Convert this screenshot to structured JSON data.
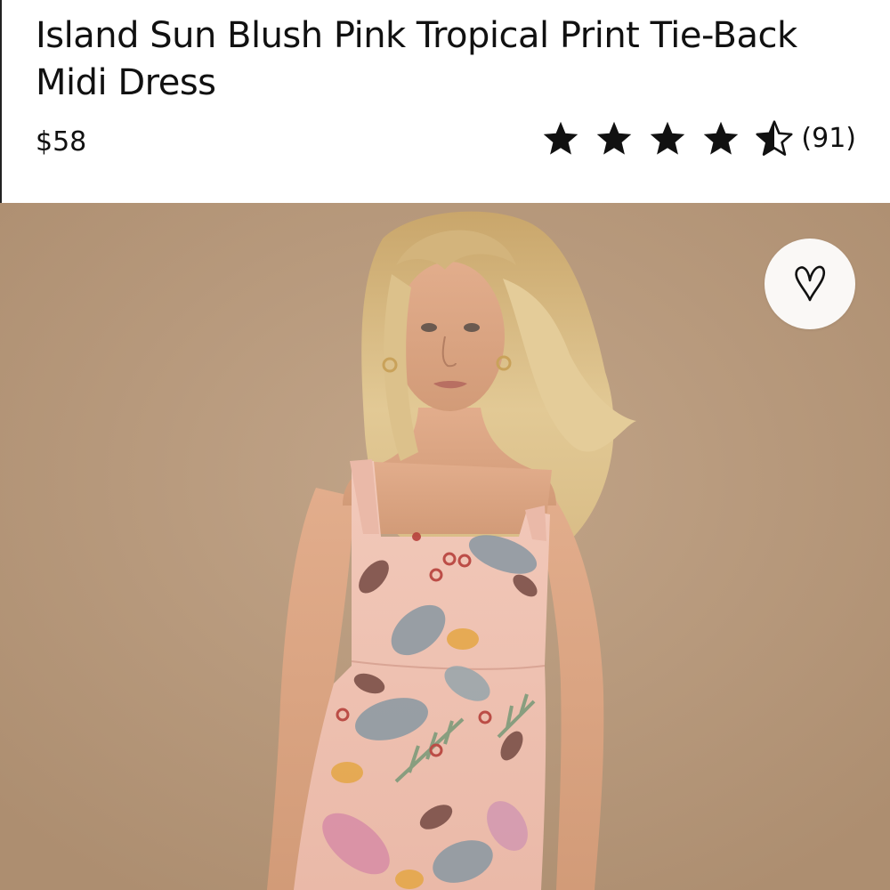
{
  "product": {
    "title": "Island Sun Blush Pink Tropical Print Tie-Back Midi Dress",
    "price": "$58",
    "rating": 4.5,
    "max_rating": 5,
    "review_count": "(91)"
  },
  "icons": {
    "star": "star-icon",
    "half_star": "half-star-icon",
    "favorite": "heart-icon"
  },
  "colors": {
    "text": "#111111",
    "photo_background": "#b89a7b",
    "favorite_button_bg": "#faf8f6",
    "dress": "#efc3b4"
  }
}
